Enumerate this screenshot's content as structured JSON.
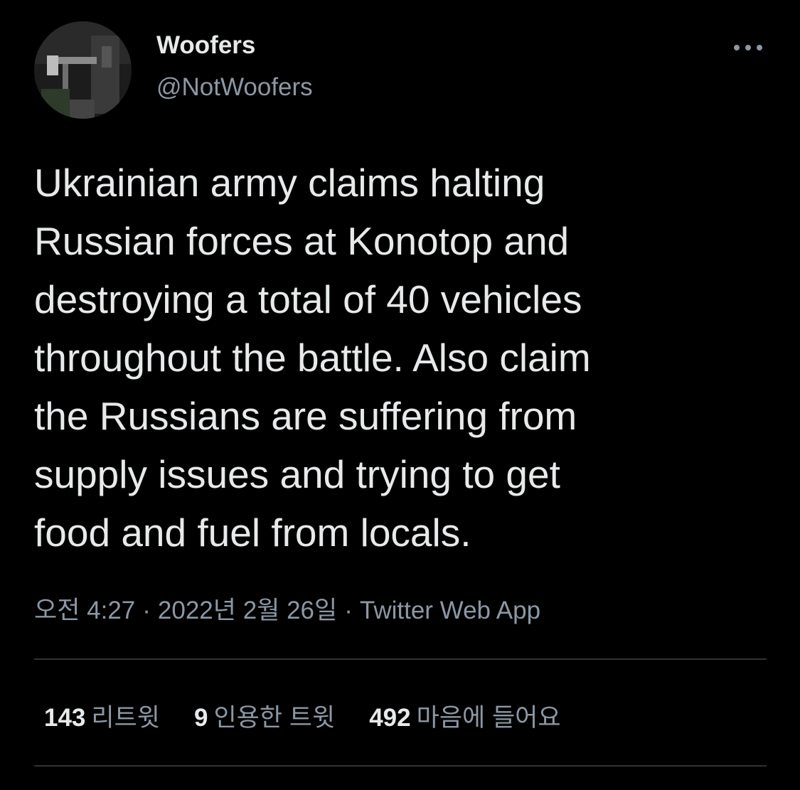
{
  "user": {
    "display_name": "Woofers",
    "handle": "@NotWoofers",
    "avatar_icon": "avatar-photo"
  },
  "tweet": {
    "lines": [
      "Ukrainian army claims halting",
      "Russian forces at Konotop and",
      "destroying a total of 40 vehicles",
      "throughout the battle. Also claim",
      "the Russians are suffering from",
      "supply issues and trying to get",
      "food and fuel from locals."
    ]
  },
  "meta": {
    "time": "오전 4:27",
    "separator": "·",
    "date": "2022년 2월 26일",
    "source": "Twitter Web App"
  },
  "stats": {
    "retweets": {
      "count": "143",
      "label": "리트윗"
    },
    "quotes": {
      "count": "9",
      "label": "인용한 트윗"
    },
    "likes": {
      "count": "492",
      "label": "마음에 들어요"
    }
  },
  "colors": {
    "background": "#000000",
    "primary_text": "#e7e9ea",
    "secondary_text": "#8b98a5",
    "divider": "#2f3336"
  },
  "icons": {
    "more": "more-dots-icon"
  }
}
